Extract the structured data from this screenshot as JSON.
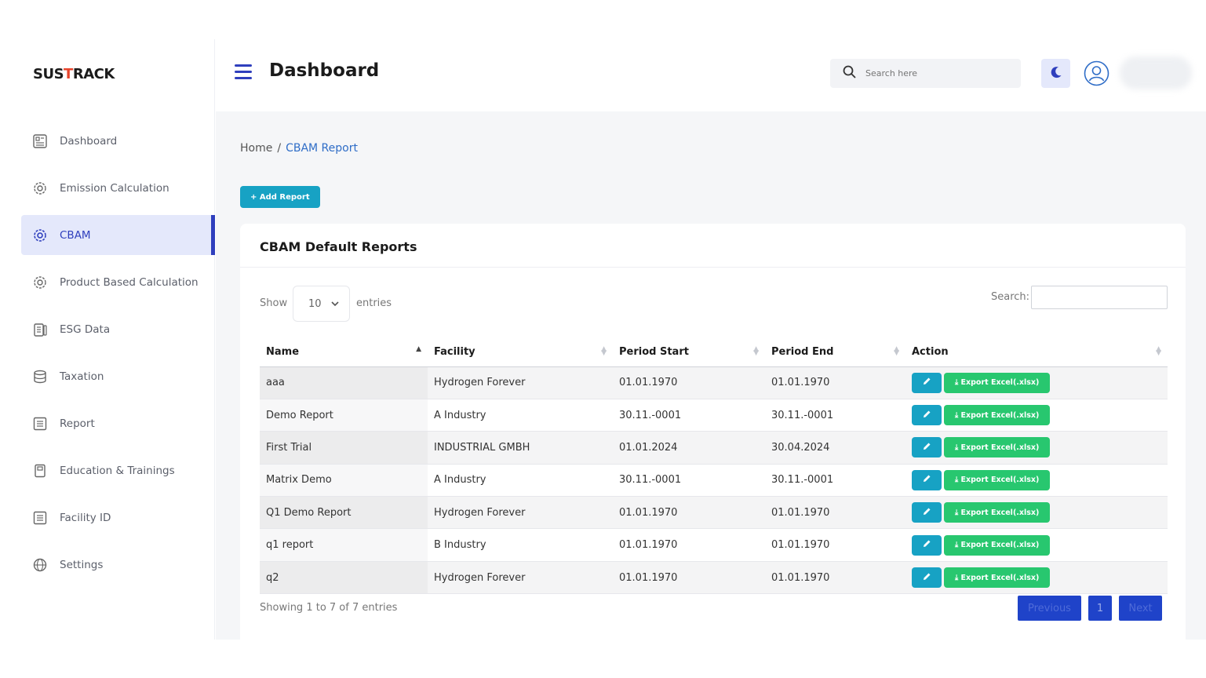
{
  "brand": {
    "logo_part1": "SUS",
    "logo_part2": "T",
    "logo_part3": "RACK"
  },
  "sidebar": {
    "items": [
      {
        "label": "Dashboard",
        "icon": "dashboard-icon"
      },
      {
        "label": "Emission Calculation",
        "icon": "gear-icon"
      },
      {
        "label": "CBAM",
        "icon": "gear-icon",
        "active": true
      },
      {
        "label": "Product Based Calculation",
        "icon": "gear-icon"
      },
      {
        "label": "ESG Data",
        "icon": "clipboard-icon"
      },
      {
        "label": "Taxation",
        "icon": "database-icon"
      },
      {
        "label": "Report",
        "icon": "list-icon"
      },
      {
        "label": "Education & Trainings",
        "icon": "book-icon"
      },
      {
        "label": "Facility ID",
        "icon": "list-icon"
      },
      {
        "label": "Settings",
        "icon": "globe-gear-icon"
      }
    ]
  },
  "header": {
    "title": "Dashboard",
    "search_placeholder": "Search here"
  },
  "breadcrumb": {
    "home": "Home",
    "separator": "/",
    "current": "CBAM Report"
  },
  "add_button": "+ Add Report",
  "card": {
    "title": "CBAM Default Reports",
    "show_label": "Show",
    "entries_value": "10",
    "entries_label": "entries",
    "search_label": "Search:"
  },
  "table": {
    "headers": [
      "Name",
      "Facility",
      "Period Start",
      "Period End",
      "Action"
    ],
    "rows": [
      {
        "name": "aaa",
        "facility": "Hydrogen Forever",
        "start": "01.01.1970",
        "end": "01.01.1970"
      },
      {
        "name": "Demo Report",
        "facility": "A Industry",
        "start": "30.11.-0001",
        "end": "30.11.-0001"
      },
      {
        "name": "First Trial",
        "facility": "INDUSTRIAL GMBH",
        "start": "01.01.2024",
        "end": "30.04.2024"
      },
      {
        "name": "Matrix Demo",
        "facility": "A Industry",
        "start": "30.11.-0001",
        "end": "30.11.-0001"
      },
      {
        "name": "Q1 Demo Report",
        "facility": "Hydrogen Forever",
        "start": "01.01.1970",
        "end": "01.01.1970"
      },
      {
        "name": "q1 report",
        "facility": "B Industry",
        "start": "01.01.1970",
        "end": "01.01.1970"
      },
      {
        "name": "q2",
        "facility": "Hydrogen Forever",
        "start": "01.01.1970",
        "end": "01.01.1970"
      }
    ],
    "export_label": "Export Excel(.xlsx)"
  },
  "footer": {
    "showing": "Showing 1 to 7 of 7 entries",
    "prev": "Previous",
    "page": "1",
    "next": "Next"
  },
  "colors": {
    "accent": "#2f3fbd",
    "teal": "#17a2c4",
    "green": "#28c76f",
    "pager": "#1f43c9"
  }
}
